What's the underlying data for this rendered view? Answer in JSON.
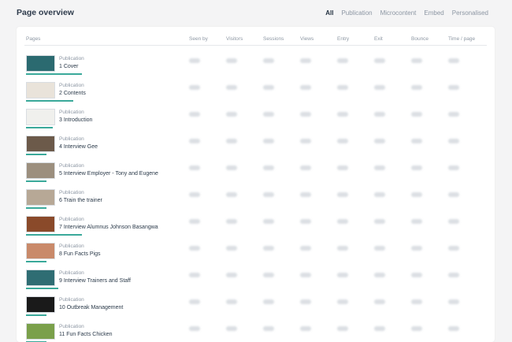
{
  "header": {
    "title": "Page overview",
    "filters": [
      {
        "label": "All",
        "active": true
      },
      {
        "label": "Publication",
        "active": false
      },
      {
        "label": "Microcontent",
        "active": false
      },
      {
        "label": "Embed",
        "active": false
      },
      {
        "label": "Personalised",
        "active": false
      }
    ]
  },
  "table": {
    "columns": [
      "Pages",
      "Seen by",
      "Visitors",
      "Sessions",
      "Views",
      "Entry",
      "Exit",
      "Bounce",
      "Time / page"
    ],
    "rows": [
      {
        "kind": "Publication",
        "name": "1 Cover",
        "thumb_color": "#2b6a70",
        "progress": 0.95
      },
      {
        "kind": "Publication",
        "name": "2 Contents",
        "thumb_color": "#e9e3da",
        "progress": 0.8
      },
      {
        "kind": "Publication",
        "name": "3 Introduction",
        "thumb_color": "#f0f0ed",
        "progress": 0.45
      },
      {
        "kind": "Publication",
        "name": "4 Interview Gee",
        "thumb_color": "#6c5a4a",
        "progress": 0.35
      },
      {
        "kind": "Publication",
        "name": "5 Interview Employer - Tony and Eugene",
        "thumb_color": "#9c8f7e",
        "progress": 0.35
      },
      {
        "kind": "Publication",
        "name": "6 Train the trainer",
        "thumb_color": "#b7a896",
        "progress": 0.35
      },
      {
        "kind": "Publication",
        "name": "7 Interview Alumnus Johnson Basangwa",
        "thumb_color": "#8a4a2a",
        "progress": 0.95
      },
      {
        "kind": "Publication",
        "name": "8 Fun Facts Pigs",
        "thumb_color": "#c98a6a",
        "progress": 0.35
      },
      {
        "kind": "Publication",
        "name": "9 Interview Trainers and Staff",
        "thumb_color": "#2f6d73",
        "progress": 0.55
      },
      {
        "kind": "Publication",
        "name": "10 Outbreak Management",
        "thumb_color": "#1a1a1a",
        "progress": 0.35
      },
      {
        "kind": "Publication",
        "name": "11 Fun Facts Chicken",
        "thumb_color": "#7aa04a",
        "progress": 0.35
      }
    ]
  }
}
